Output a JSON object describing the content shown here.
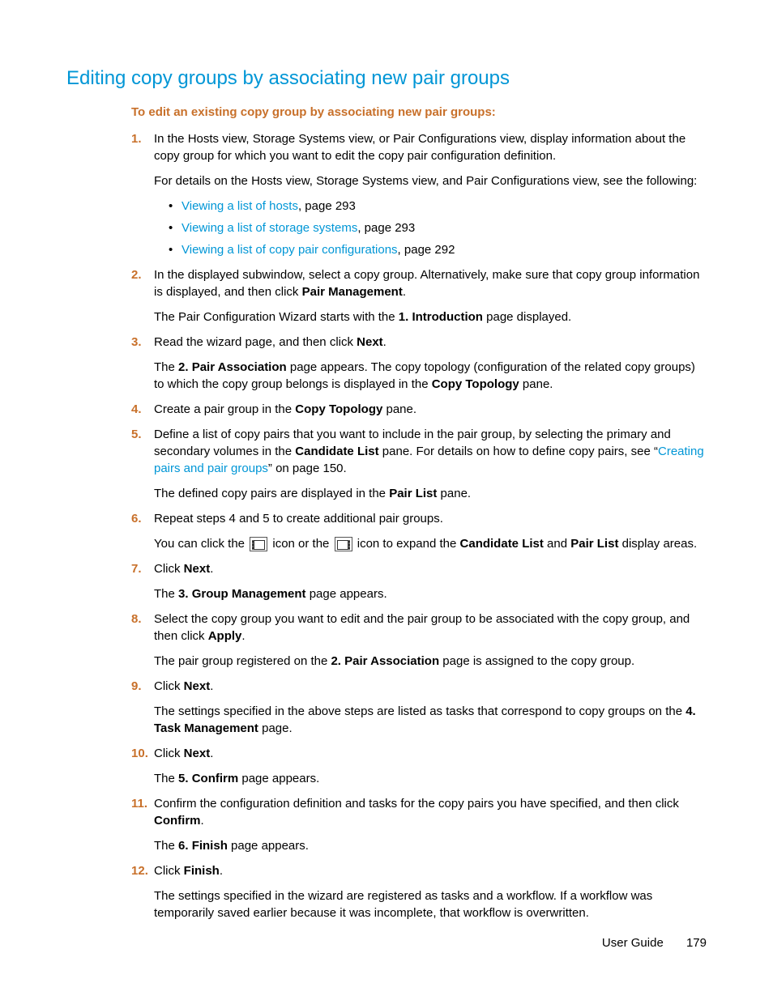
{
  "title": "Editing copy groups by associating new pair groups",
  "intro": "To edit an existing copy group by associating new pair groups:",
  "steps": {
    "s1": {
      "p1a": "In the Hosts view, Storage Systems view, or Pair Configurations view, display information about the copy group for which you want to edit the copy pair configuration definition.",
      "p1b": "For details on the Hosts view, Storage Systems view, and Pair Configurations view, see the following:",
      "links": {
        "l1": "Viewing a list of hosts",
        "l1_suffix": ", page 293",
        "l2": "Viewing a list of storage systems",
        "l2_suffix": ", page 293",
        "l3": "Viewing a list of copy pair configurations",
        "l3_suffix": ", page 292"
      }
    },
    "s2": {
      "p1_a": "In the displayed subwindow, select a copy group. Alternatively, make sure that copy group information is displayed, and then click ",
      "p1_b": "Pair Management",
      "p1_c": ".",
      "p2_a": "The Pair Configuration Wizard starts with the ",
      "p2_b": "1. Introduction",
      "p2_c": " page displayed."
    },
    "s3": {
      "p1_a": "Read the wizard page, and then click ",
      "p1_b": "Next",
      "p1_c": ".",
      "p2_a": "The ",
      "p2_b": "2. Pair Association",
      "p2_c": " page appears. The copy topology (configuration of the related copy groups) to which the copy group belongs is displayed in the ",
      "p2_d": "Copy Topology",
      "p2_e": " pane."
    },
    "s4": {
      "p1_a": "Create a pair group in the ",
      "p1_b": "Copy Topology",
      "p1_c": " pane."
    },
    "s5": {
      "p1_a": "Define a list of copy pairs that you want to include in the pair group, by selecting the primary and secondary volumes in the ",
      "p1_b": "Candidate List",
      "p1_c": " pane. For details on how to define copy pairs, see “",
      "p1_link": "Creating pairs and pair groups",
      "p1_d": "” on page 150.",
      "p2_a": "The defined copy pairs are displayed in the ",
      "p2_b": "Pair List",
      "p2_c": " pane."
    },
    "s6": {
      "p1": "Repeat steps 4 and 5 to create additional pair groups.",
      "p2_a": "You can click the ",
      "p2_b": " icon or the ",
      "p2_c": " icon to expand the ",
      "p2_d": "Candidate List",
      "p2_e": " and ",
      "p2_f": "Pair List",
      "p2_g": " display areas."
    },
    "s7": {
      "p1_a": "Click ",
      "p1_b": "Next",
      "p1_c": ".",
      "p2_a": "The ",
      "p2_b": "3. Group Management",
      "p2_c": " page appears."
    },
    "s8": {
      "p1_a": "Select the copy group you want to edit and the pair group to be associated with the copy group, and then click ",
      "p1_b": "Apply",
      "p1_c": ".",
      "p2_a": "The pair group registered on the ",
      "p2_b": "2. Pair Association",
      "p2_c": " page is assigned to the copy group."
    },
    "s9": {
      "p1_a": "Click ",
      "p1_b": "Next",
      "p1_c": ".",
      "p2_a": "The settings specified in the above steps are listed as tasks that correspond to copy groups on the ",
      "p2_b": "4. Task Management",
      "p2_c": " page."
    },
    "s10": {
      "p1_a": "Click ",
      "p1_b": "Next",
      "p1_c": ".",
      "p2_a": "The ",
      "p2_b": "5. Confirm",
      "p2_c": " page appears."
    },
    "s11": {
      "p1_a": "Confirm the configuration definition and tasks for the copy pairs you have specified, and then click ",
      "p1_b": "Confirm",
      "p1_c": ".",
      "p2_a": "The ",
      "p2_b": "6. Finish",
      "p2_c": " page appears."
    },
    "s12": {
      "p1_a": "Click ",
      "p1_b": "Finish",
      "p1_c": ".",
      "p2": "The settings specified in the wizard are registered as tasks and a workflow. If a workflow was temporarily saved earlier because it was incomplete, that workflow is overwritten."
    }
  },
  "footer": {
    "label": "User Guide",
    "page": "179"
  }
}
